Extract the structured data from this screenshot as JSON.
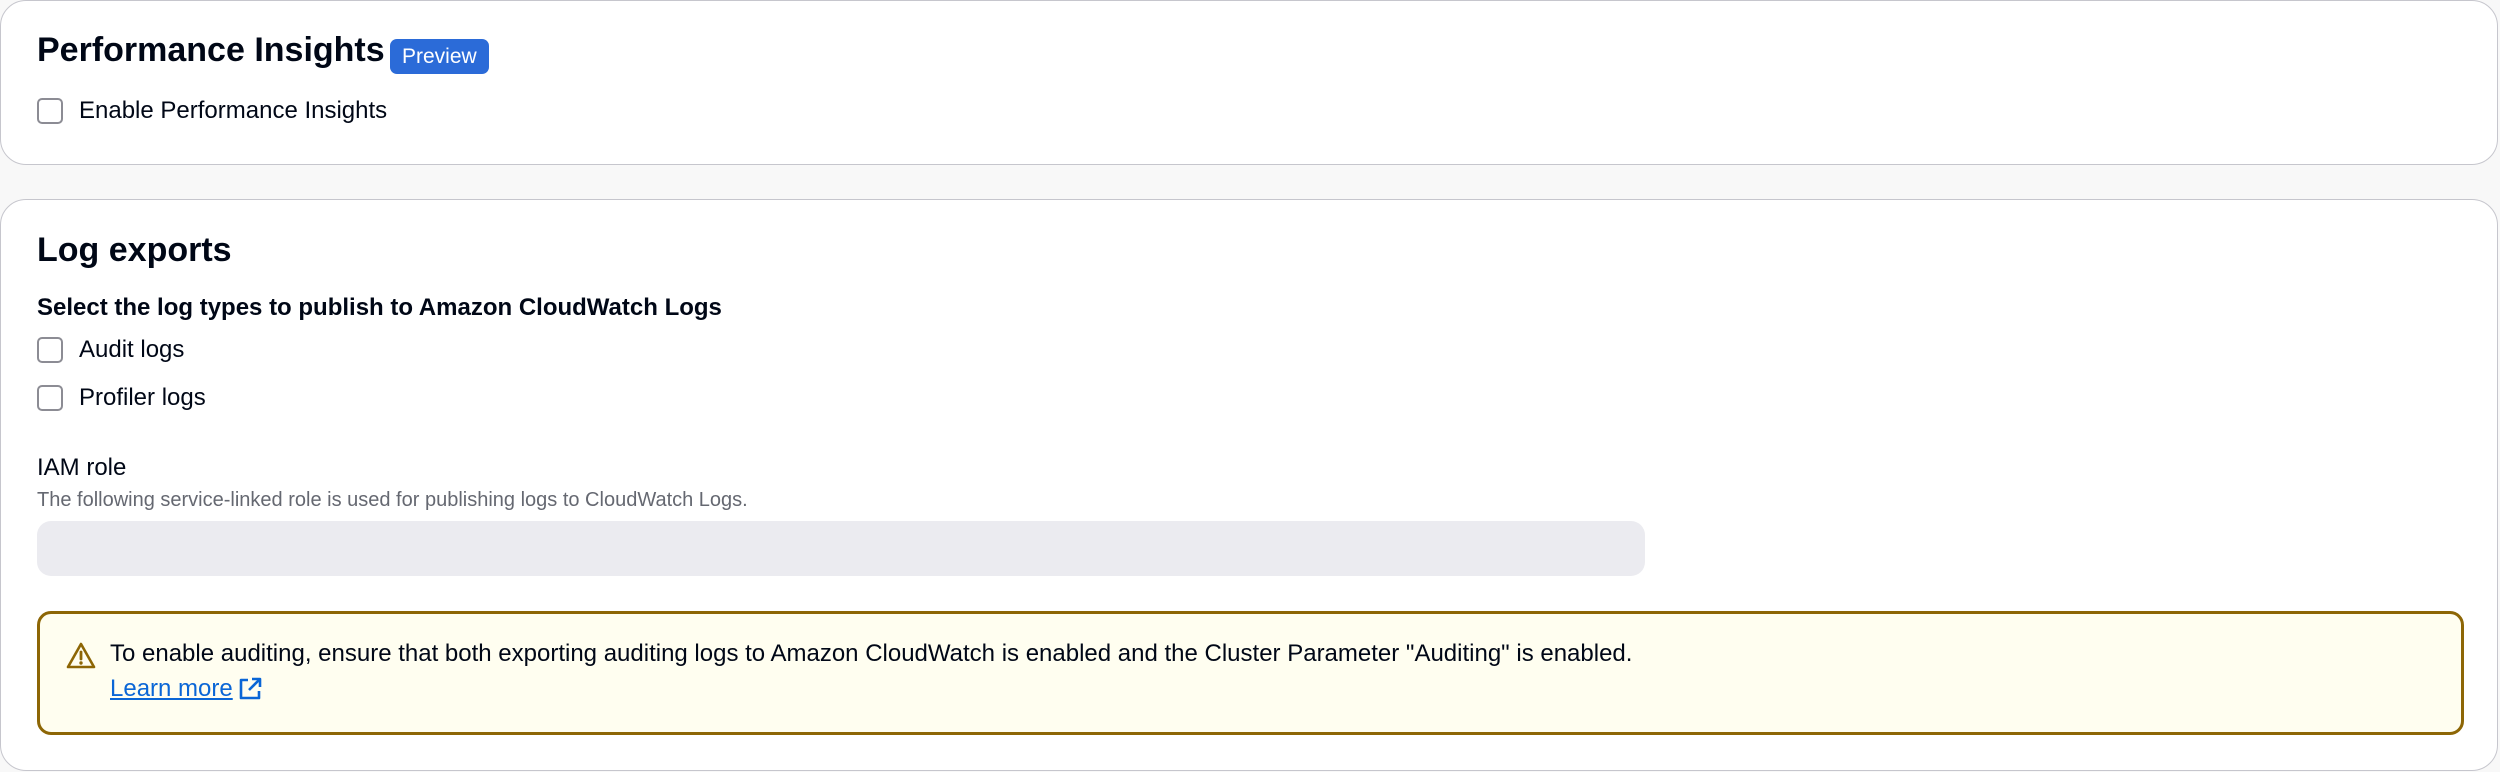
{
  "performance_insights": {
    "title": "Performance Insights",
    "badge": "Preview",
    "enable_label": "Enable Performance Insights",
    "enabled": false
  },
  "log_exports": {
    "title": "Log exports",
    "select_heading": "Select the log types to publish to Amazon CloudWatch Logs",
    "options": [
      {
        "label": "Audit logs",
        "checked": false
      },
      {
        "label": "Profiler logs",
        "checked": false
      }
    ],
    "iam_role": {
      "label": "IAM role",
      "description": "The following service-linked role is used for publishing logs to CloudWatch Logs.",
      "value": ""
    },
    "alert": {
      "icon": "warning-icon",
      "text": "To enable auditing, ensure that both exporting auditing logs to Amazon CloudWatch is enabled and the Cluster Parameter \"Auditing\" is enabled.",
      "link_text": "Learn more",
      "link_icon": "external-link-icon"
    }
  },
  "colors": {
    "badge": "#2b6bd8",
    "link": "#0a66d6",
    "alert_border": "#8d6605",
    "alert_background": "#fffef0",
    "input_background": "#ebebf0"
  }
}
